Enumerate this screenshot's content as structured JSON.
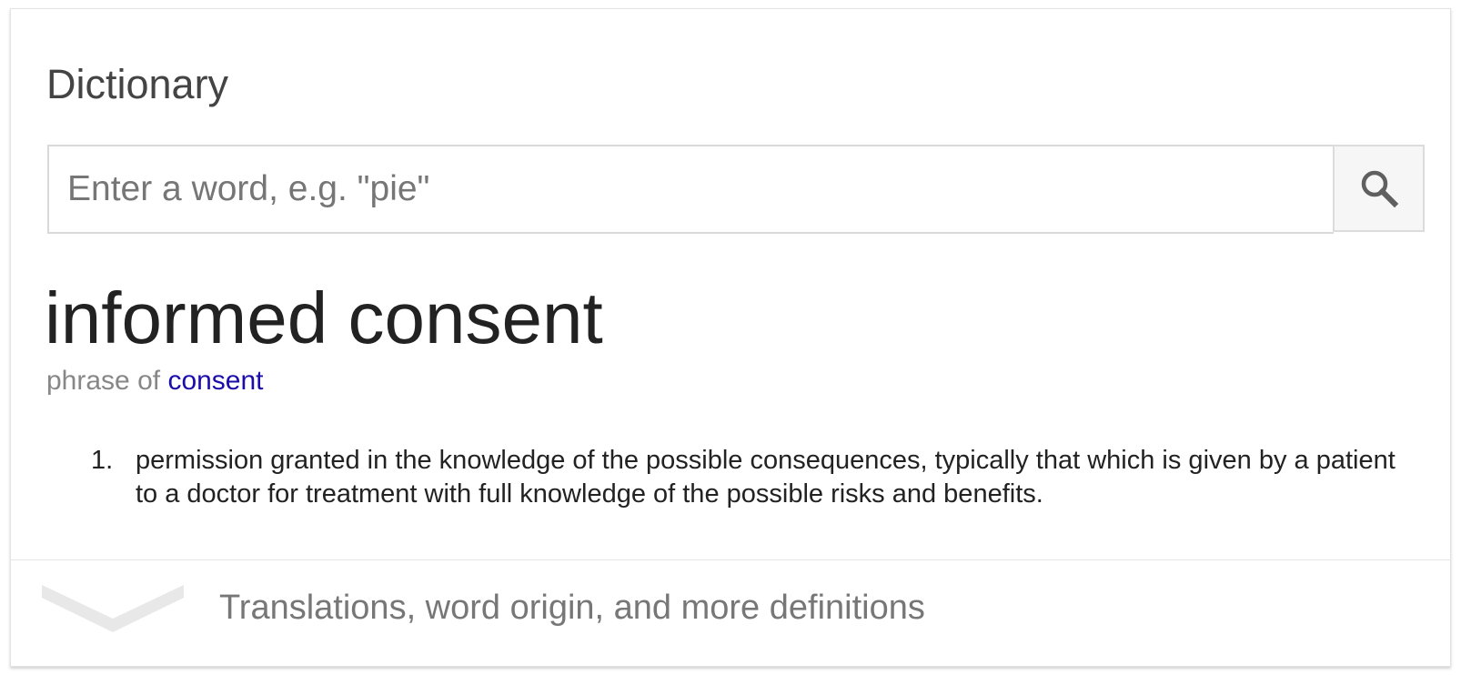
{
  "dictionary": {
    "section_title": "Dictionary",
    "search": {
      "placeholder": "Enter a word, e.g. \"pie\"",
      "value": "",
      "button_icon": "search-icon"
    },
    "entry": {
      "headword": "informed consent",
      "phrase_prefix": "phrase of",
      "phrase_link": "consent",
      "definitions": [
        {
          "number": "1.",
          "text": "permission granted in the knowledge of the possible consequences, typically that which is given by a patient to a doctor for treatment with full knowledge of the possible risks and benefits."
        }
      ]
    },
    "more": {
      "icon": "chevron-down-icon",
      "label": "Translations, word origin, and more definitions"
    },
    "colors": {
      "link": "#1a0dab",
      "text": "#222222",
      "muted": "#878787",
      "border": "#d9d9d9",
      "button_bg": "#f6f6f6"
    }
  }
}
